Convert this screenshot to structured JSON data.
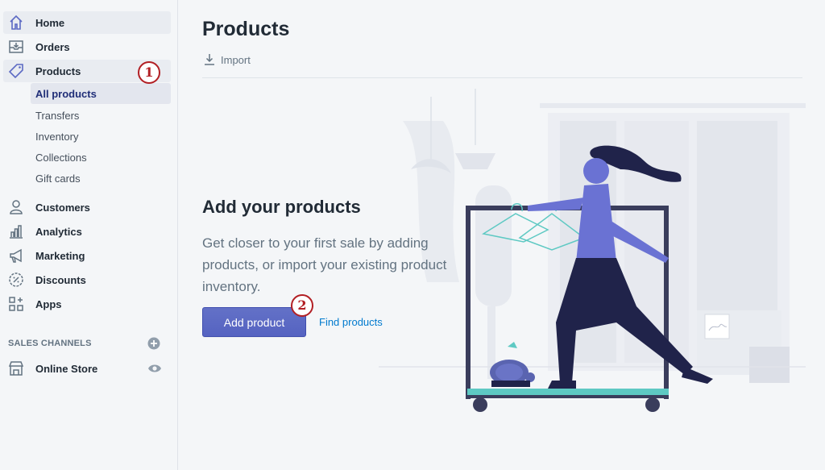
{
  "sidebar": {
    "items": [
      {
        "label": "Home",
        "icon": "home-icon"
      },
      {
        "label": "Orders",
        "icon": "orders-icon"
      },
      {
        "label": "Products",
        "icon": "tag-icon"
      }
    ],
    "product_subitems": [
      "All products",
      "Transfers",
      "Inventory",
      "Collections",
      "Gift cards"
    ],
    "items2": [
      {
        "label": "Customers",
        "icon": "person-icon"
      },
      {
        "label": "Analytics",
        "icon": "bar-chart-icon"
      },
      {
        "label": "Marketing",
        "icon": "megaphone-icon"
      },
      {
        "label": "Discounts",
        "icon": "discount-icon"
      },
      {
        "label": "Apps",
        "icon": "apps-icon"
      }
    ],
    "sales_channels_heading": "SALES CHANNELS",
    "online_store": {
      "label": "Online Store",
      "icon": "store-icon"
    }
  },
  "callouts": [
    "1",
    "2"
  ],
  "main": {
    "title": "Products",
    "import_label": "Import",
    "empty_state": {
      "heading": "Add your products",
      "body": "Get closer to your first sale by adding products, or import your existing product inventory.",
      "primary_button": "Add product",
      "secondary_link": "Find products"
    }
  },
  "colors": {
    "primary": "#5c6ac4",
    "link": "#007ace",
    "callout": "#b21f24",
    "sidebar_bg": "#f4f6f8"
  }
}
